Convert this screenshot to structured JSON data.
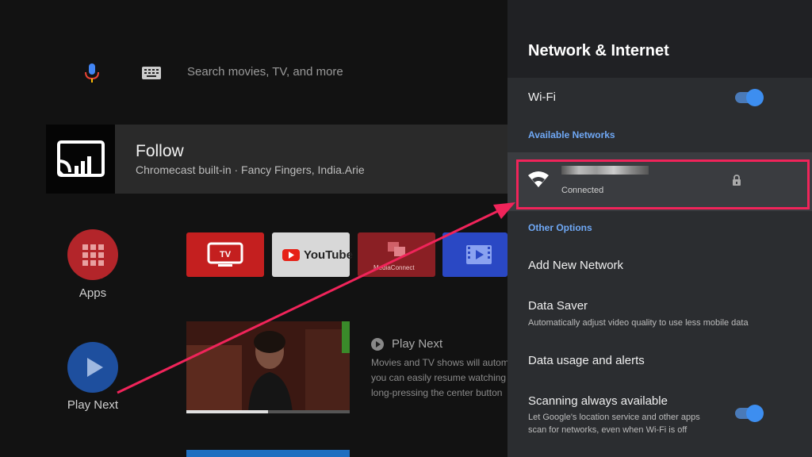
{
  "home": {
    "search": {
      "placeholder": "Search movies, TV, and more",
      "mic_icon": "mic-icon",
      "keyboard_icon": "keyboard-icon"
    },
    "follow_card": {
      "title": "Follow",
      "subtitle": "Chromecast built-in · Fancy Fingers, India.Arie",
      "icon": "cast-icon"
    },
    "apps": {
      "label": "Apps",
      "icon": "grid-icon",
      "color": "#b3252a"
    },
    "play_next": {
      "label": "Play Next",
      "icon": "play-icon",
      "color": "#1e4f9e"
    },
    "app_tiles": [
      {
        "name": "tv-app-tile",
        "label": "TV",
        "icon": "tv-icon",
        "color": "#c41f1f"
      },
      {
        "name": "youtube-tile",
        "label": "YouTube",
        "icon": "youtube-icon",
        "color": "#d8d8d8"
      },
      {
        "name": "mediaconnect-tile",
        "label": "MediaConnect",
        "icon": "media-connect-icon",
        "color": "#8a1f24"
      },
      {
        "name": "video-player-tile",
        "label": "",
        "icon": "film-icon",
        "color": "#2a48c4"
      }
    ],
    "play_next_info": {
      "title": "Play Next",
      "lines": [
        "Movies and TV shows will autom",
        "you can easily resume watching",
        "long-pressing the center button"
      ]
    },
    "video_progress_percent": 50
  },
  "panel": {
    "title": "Network & Internet",
    "wifi": {
      "label": "Wi-Fi",
      "enabled": true
    },
    "available_networks_label": "Available Networks",
    "network": {
      "ssid": "",
      "status": "Connected",
      "wifi_icon": "wifi-icon",
      "lock_icon": "lock-icon"
    },
    "other_options_label": "Other Options",
    "add_network": "Add New Network",
    "data_saver": {
      "label": "Data Saver",
      "description": "Automatically adjust video quality to use less mobile data"
    },
    "data_usage": "Data usage and alerts",
    "scanning": {
      "label": "Scanning always available",
      "description_line1": "Let Google's location service and other apps",
      "description_line2": "scan for networks, even when Wi-Fi is off",
      "enabled": true
    }
  },
  "colors": {
    "accent_blue": "#3d8ef0",
    "section_label": "#6fa8f5",
    "annotation_pink": "#f0245a"
  }
}
